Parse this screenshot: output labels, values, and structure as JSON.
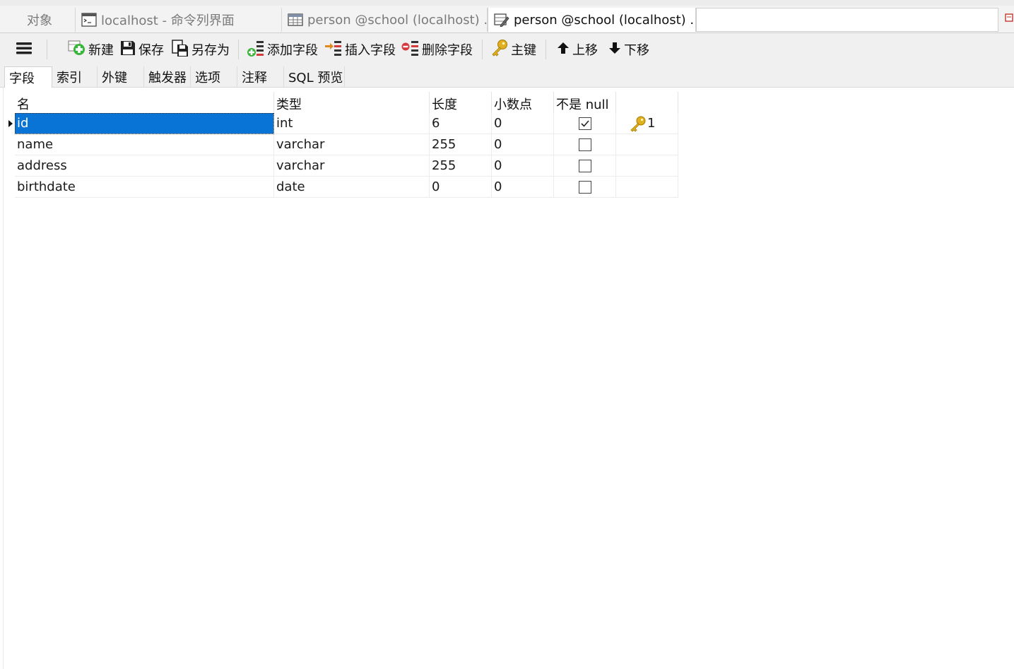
{
  "tabs": [
    {
      "label": "对象",
      "icon": "none",
      "active": false
    },
    {
      "label": "localhost - 命令列界面",
      "icon": "console-icon",
      "active": false
    },
    {
      "label": "person @school (localhost) ...",
      "icon": "table-icon",
      "active": false
    },
    {
      "label": "person @school (localhost) ...",
      "icon": "table-design-icon",
      "active": true
    }
  ],
  "toolbar": {
    "menu_icon": "hamburger-icon",
    "new_label": "新建",
    "save_label": "保存",
    "save_as_label": "另存为",
    "add_field_label": "添加字段",
    "insert_field_label": "插入字段",
    "delete_field_label": "删除字段",
    "primary_key_label": "主键",
    "move_up_label": "上移",
    "move_down_label": "下移"
  },
  "subtabs": [
    {
      "label": "字段",
      "active": true
    },
    {
      "label": "索引",
      "active": false
    },
    {
      "label": "外键",
      "active": false
    },
    {
      "label": "触发器",
      "active": false
    },
    {
      "label": "选项",
      "active": false
    },
    {
      "label": "注释",
      "active": false
    },
    {
      "label": "SQL 预览",
      "active": false
    }
  ],
  "grid": {
    "columns": [
      "名",
      "类型",
      "长度",
      "小数点",
      "不是 null",
      ""
    ],
    "rows": [
      {
        "name": "id",
        "type": "int",
        "length": "6",
        "decimals": "0",
        "not_null": true,
        "key": "1",
        "selected": true
      },
      {
        "name": "name",
        "type": "varchar",
        "length": "255",
        "decimals": "0",
        "not_null": false,
        "key": "",
        "selected": false
      },
      {
        "name": "address",
        "type": "varchar",
        "length": "255",
        "decimals": "0",
        "not_null": false,
        "key": "",
        "selected": false
      },
      {
        "name": "birthdate",
        "type": "date",
        "length": "0",
        "decimals": "0",
        "not_null": false,
        "key": "",
        "selected": false
      }
    ]
  },
  "colors": {
    "selection": "#0a74d6",
    "add_green": "#3bb43b",
    "delete_red": "#d63a3a",
    "key_gold": "#e0b020"
  }
}
